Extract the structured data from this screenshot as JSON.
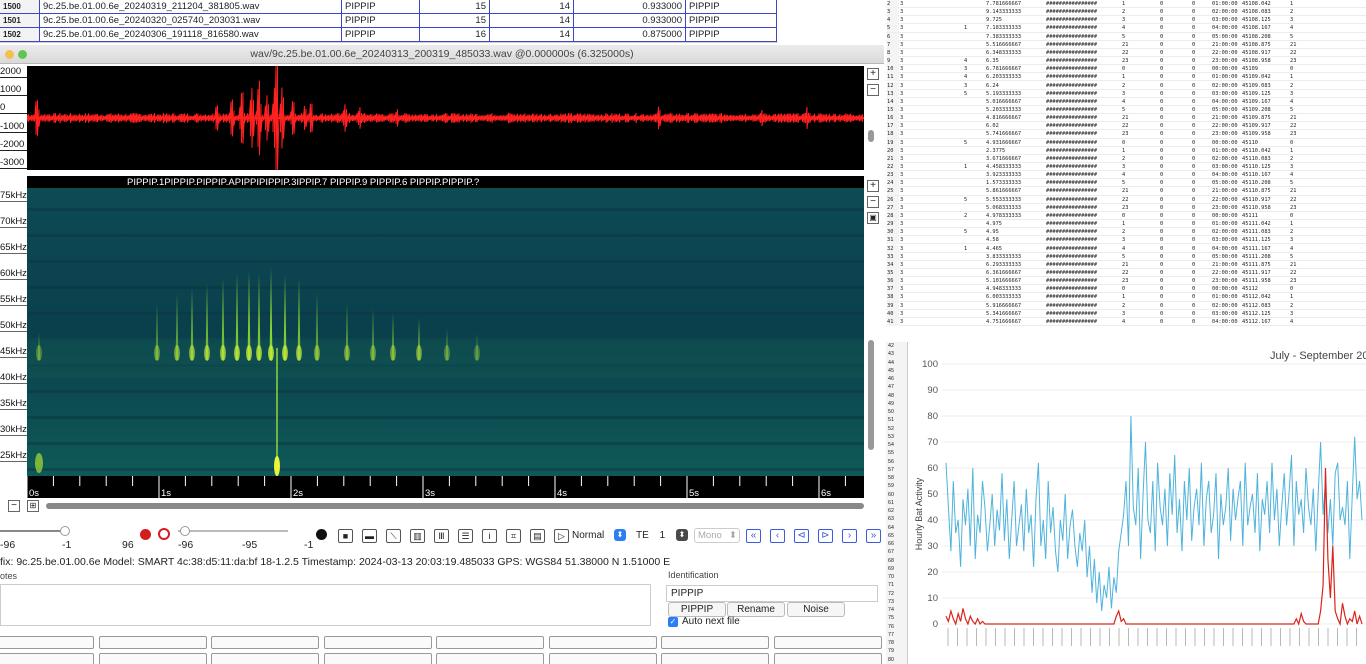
{
  "file_table": {
    "rows": [
      {
        "idx": "1500",
        "file": "9c.25.be.01.00.6e_20240319_211204_381805.wav",
        "species": "PIPPIP",
        "a": "15",
        "b": "14",
        "score": "0.933000",
        "label": "PIPPIP"
      },
      {
        "idx": "1501",
        "file": "9c.25.be.01.00.6e_20240320_025740_203031.wav",
        "species": "PIPPIP",
        "a": "15",
        "b": "14",
        "score": "0.933000",
        "label": "PIPPIP"
      },
      {
        "idx": "1502",
        "file": "9c.25.be.01.00.6e_20240306_191118_816580.wav",
        "species": "PIPPIP",
        "a": "16",
        "b": "14",
        "score": "0.875000",
        "label": "PIPPIP"
      }
    ]
  },
  "window": {
    "title": "wav/9c.25.be.01.00.6e_20240313_200319_485033.wav @0.000000s (6.325000s)"
  },
  "waveform": {
    "y_labels": [
      "2000",
      "1000",
      "0",
      "-1000",
      "-2000",
      "-3000"
    ]
  },
  "spectrogram": {
    "freq_labels": [
      "75kHz",
      "70kHz",
      "65kHz",
      "60kHz",
      "55kHz",
      "50kHz",
      "45kHz",
      "40kHz",
      "35kHz",
      "30kHz",
      "25kHz"
    ],
    "time_labels": [
      "0s",
      "1s",
      "2s",
      "3s",
      "4s",
      "5s",
      "6s"
    ],
    "annotations": [
      "PIPPIP.1",
      "PIPPIP.2",
      "PIPPIP.3",
      "PIPPIP.4",
      "PIPPIP.5",
      "PIPPIP.6",
      "PIPPIP.7",
      "PIPPIP.9",
      "PIPPIP.6",
      "PIPPIP.?"
    ],
    "annotation_text": "PIPPIP.1PIPPIP.PIPPIP.APIPPIPIPPIP.3IPPIP.7  PIPPIP.9  PIPPIP.6   PIPPIP.PIPPIP.?"
  },
  "controls": {
    "slider_labels": [
      "-96",
      "-1",
      "96",
      "-96",
      "-95",
      "-1"
    ],
    "play_mode": "Normal",
    "te_label": "TE",
    "te_value": "1",
    "channel": "Mono"
  },
  "info_line": "fix: 9c.25.be.01.00.6e   Model: SMART 4c:38:d5:11:da:bf 18-1.2.5   Timestamp: 2024-03-13 20:03:19.485033   GPS: WGS84 51.38000 N 1.51000 E",
  "notes_label": "otes",
  "identification": {
    "label": "Identification",
    "value": "PIPPIP",
    "buttons": [
      "PIPPIP",
      "Rename",
      "Noise"
    ],
    "auto_next": "Auto next file",
    "auto_next_checked": true
  },
  "spreadsheet": {
    "rows": [
      [
        "2",
        "3",
        "",
        "7.781666667",
        "1",
        "0",
        "0",
        "01:00:00",
        "45108.042",
        "1"
      ],
      [
        "3",
        "3",
        "",
        "9.143333333",
        "2",
        "0",
        "0",
        "02:00:00",
        "45108.083",
        "2"
      ],
      [
        "4",
        "3",
        "",
        "9.725",
        "3",
        "0",
        "0",
        "03:00:00",
        "45108.125",
        "3"
      ],
      [
        "5",
        "3",
        "1",
        "7.183333333",
        "4",
        "0",
        "0",
        "04:00:00",
        "45108.167",
        "4"
      ],
      [
        "6",
        "3",
        "",
        "7.383333333",
        "5",
        "0",
        "0",
        "05:00:00",
        "45108.208",
        "5"
      ],
      [
        "7",
        "3",
        "",
        "5.516666667",
        "21",
        "0",
        "0",
        "21:00:00",
        "45108.875",
        "21"
      ],
      [
        "8",
        "3",
        "",
        "6.348333333",
        "22",
        "0",
        "0",
        "22:00:00",
        "45108.917",
        "22"
      ],
      [
        "9",
        "3",
        "4",
        "6.35",
        "23",
        "0",
        "0",
        "23:00:00",
        "45108.958",
        "23"
      ],
      [
        "10",
        "3",
        "3",
        "6.781666667",
        "0",
        "0",
        "0",
        "00:00:00",
        "45109",
        "0"
      ],
      [
        "11",
        "3",
        "4",
        "6.203333333",
        "1",
        "0",
        "0",
        "01:00:00",
        "45109.042",
        "1"
      ],
      [
        "12",
        "3",
        "3",
        "6.24",
        "2",
        "0",
        "0",
        "02:00:00",
        "45109.083",
        "2"
      ],
      [
        "13",
        "3",
        "5",
        "5.193333333",
        "3",
        "0",
        "0",
        "03:00:00",
        "45109.125",
        "3"
      ],
      [
        "14",
        "3",
        "",
        "5.016666667",
        "4",
        "0",
        "0",
        "04:00:00",
        "45109.167",
        "4"
      ],
      [
        "15",
        "3",
        "",
        "5.203333333",
        "5",
        "0",
        "0",
        "05:00:00",
        "45109.208",
        "5"
      ],
      [
        "16",
        "3",
        "",
        "4.816666667",
        "21",
        "0",
        "0",
        "21:00:00",
        "45109.875",
        "21"
      ],
      [
        "17",
        "3",
        "",
        "6.02",
        "22",
        "0",
        "0",
        "22:00:00",
        "45109.917",
        "22"
      ],
      [
        "18",
        "3",
        "",
        "5.741666667",
        "23",
        "0",
        "0",
        "23:00:00",
        "45109.958",
        "23"
      ],
      [
        "19",
        "3",
        "5",
        "4.931666667",
        "0",
        "0",
        "0",
        "00:00:00",
        "45110",
        "0"
      ],
      [
        "20",
        "3",
        "",
        "2.3775",
        "1",
        "0",
        "0",
        "01:00:00",
        "45110.042",
        "1"
      ],
      [
        "21",
        "3",
        "",
        "3.671666667",
        "2",
        "0",
        "0",
        "02:00:00",
        "45110.083",
        "2"
      ],
      [
        "22",
        "3",
        "1",
        "4.458333333",
        "3",
        "0",
        "0",
        "03:00:00",
        "45110.125",
        "3"
      ],
      [
        "23",
        "3",
        "",
        "3.923333333",
        "4",
        "0",
        "0",
        "04:00:00",
        "45110.167",
        "4"
      ],
      [
        "24",
        "3",
        "",
        "1.573333333",
        "5",
        "0",
        "0",
        "05:00:00",
        "45110.208",
        "5"
      ],
      [
        "25",
        "3",
        "",
        "5.861666667",
        "21",
        "0",
        "0",
        "21:00:00",
        "45110.875",
        "21"
      ],
      [
        "26",
        "3",
        "5",
        "5.553333333",
        "22",
        "0",
        "0",
        "22:00:00",
        "45110.917",
        "22"
      ],
      [
        "27",
        "3",
        "",
        "5.068333333",
        "23",
        "0",
        "0",
        "23:00:00",
        "45110.958",
        "23"
      ],
      [
        "28",
        "3",
        "2",
        "4.978333333",
        "0",
        "0",
        "0",
        "00:00:00",
        "45111",
        "0"
      ],
      [
        "29",
        "3",
        "",
        "4.975",
        "1",
        "0",
        "0",
        "01:00:00",
        "45111.042",
        "1"
      ],
      [
        "30",
        "3",
        "5",
        "4.95",
        "2",
        "0",
        "0",
        "02:00:00",
        "45111.083",
        "2"
      ],
      [
        "31",
        "3",
        "",
        "4.58",
        "3",
        "0",
        "0",
        "03:00:00",
        "45111.125",
        "3"
      ],
      [
        "32",
        "3",
        "1",
        "4.465",
        "4",
        "0",
        "0",
        "04:00:00",
        "45111.167",
        "4"
      ],
      [
        "33",
        "3",
        "",
        "3.833333333",
        "5",
        "0",
        "0",
        "05:00:00",
        "45111.208",
        "5"
      ],
      [
        "34",
        "3",
        "",
        "6.293333333",
        "21",
        "0",
        "0",
        "21:00:00",
        "45111.875",
        "21"
      ],
      [
        "35",
        "3",
        "",
        "6.361666667",
        "22",
        "0",
        "0",
        "22:00:00",
        "45111.917",
        "22"
      ],
      [
        "36",
        "3",
        "",
        "5.101666667",
        "23",
        "0",
        "0",
        "23:00:00",
        "45111.958",
        "23"
      ],
      [
        "37",
        "3",
        "",
        "4.948333333",
        "0",
        "0",
        "0",
        "00:00:00",
        "45112",
        "0"
      ],
      [
        "38",
        "3",
        "",
        "6.003333333",
        "1",
        "0",
        "0",
        "01:00:00",
        "45112.042",
        "1"
      ],
      [
        "39",
        "3",
        "",
        "5.916666667",
        "2",
        "0",
        "0",
        "02:00:00",
        "45112.083",
        "2"
      ],
      [
        "40",
        "3",
        "",
        "5.341666667",
        "3",
        "0",
        "0",
        "03:00:00",
        "45112.125",
        "3"
      ],
      [
        "41",
        "3",
        "",
        "4.751666667",
        "4",
        "0",
        "0",
        "04:00:00",
        "45112.167",
        "4"
      ]
    ],
    "hash_text": "################"
  },
  "chart_row_numbers": [
    "42",
    "43",
    "44",
    "45",
    "46",
    "47",
    "48",
    "49",
    "50",
    "51",
    "52",
    "53",
    "54",
    "55",
    "56",
    "57",
    "58",
    "59",
    "60",
    "61",
    "62",
    "63",
    "64",
    "65",
    "66",
    "67",
    "68",
    "69",
    "70",
    "71",
    "72",
    "73",
    "74",
    "75",
    "76",
    "77",
    "78",
    "79",
    "80"
  ],
  "chart_data": {
    "type": "line",
    "title": "July - September 202",
    "ylabel": "Hourly Bat Activity",
    "ylim": [
      0,
      100
    ],
    "yticks": [
      0,
      10,
      20,
      30,
      40,
      50,
      60,
      70,
      80,
      90,
      100
    ],
    "colors": {
      "series1": "#4fb3dc",
      "series2": "#d9241c"
    },
    "series": [
      {
        "values": [
          62,
          45,
          28,
          55,
          35,
          40,
          22,
          48,
          38,
          52,
          30,
          60,
          25,
          42,
          35,
          55,
          45,
          28,
          38,
          50,
          30,
          44,
          36,
          58,
          32,
          48,
          25,
          40,
          55,
          30,
          38,
          46,
          28,
          52,
          35,
          42,
          22,
          48,
          62,
          30,
          40,
          25,
          55,
          35,
          45,
          28,
          20,
          40,
          32,
          50,
          25,
          38,
          44,
          30,
          22,
          35,
          28,
          40,
          18,
          30,
          12,
          25,
          8,
          20,
          5,
          15,
          10,
          22,
          6,
          18,
          12,
          28,
          35,
          42,
          55,
          30,
          80,
          45,
          38,
          60,
          25,
          50,
          70,
          40,
          35,
          55,
          28,
          62,
          45,
          38,
          52,
          30,
          58,
          42,
          65,
          35,
          48,
          28,
          55,
          40,
          60,
          32,
          45,
          52,
          38,
          62,
          30,
          48,
          55,
          35,
          42,
          58,
          25,
          50,
          38,
          45,
          60,
          32,
          52,
          40,
          48,
          55,
          30,
          62,
          38,
          45,
          50,
          35,
          58,
          28,
          48,
          42,
          55,
          35,
          62,
          40,
          52,
          30,
          45,
          58,
          38,
          50,
          65,
          30,
          55,
          42,
          48,
          35,
          60,
          45,
          38,
          52,
          28,
          50,
          70,
          42,
          55,
          35,
          48,
          30,
          58,
          62,
          40,
          45,
          38,
          55,
          25,
          50,
          72,
          48,
          55,
          40
        ]
      },
      {
        "values": [
          3,
          1,
          5,
          2,
          0,
          4,
          1,
          6,
          2,
          0,
          3,
          1,
          0,
          2,
          0,
          1,
          0,
          0,
          0,
          0,
          0,
          0,
          0,
          0,
          0,
          0,
          0,
          0,
          0,
          0,
          0,
          0,
          0,
          0,
          0,
          0,
          0,
          0,
          0,
          0,
          0,
          0,
          0,
          0,
          0,
          0,
          0,
          0,
          0,
          0,
          0,
          0,
          0,
          0,
          0,
          0,
          0,
          0,
          0,
          0,
          0,
          0,
          0,
          0,
          0,
          0,
          0,
          0,
          0,
          0,
          3,
          5,
          1,
          2,
          0,
          0,
          0,
          0,
          0,
          0,
          0,
          0,
          0,
          0,
          0,
          0,
          0,
          0,
          0,
          0,
          0,
          0,
          0,
          0,
          0,
          0,
          0,
          0,
          0,
          0,
          0,
          0,
          0,
          0,
          0,
          0,
          0,
          0,
          0,
          0,
          0,
          0,
          0,
          0,
          0,
          0,
          0,
          0,
          0,
          0,
          0,
          0,
          0,
          0,
          0,
          0,
          0,
          0,
          0,
          0,
          0,
          0,
          0,
          0,
          0,
          0,
          0,
          0,
          0,
          0,
          0,
          0,
          0,
          0,
          2,
          0,
          4,
          1,
          0,
          0,
          0,
          0,
          0,
          0,
          5,
          15,
          60,
          25,
          10,
          30,
          5,
          2,
          0,
          8,
          3,
          0,
          2,
          1,
          5,
          0,
          3,
          0
        ]
      }
    ]
  }
}
